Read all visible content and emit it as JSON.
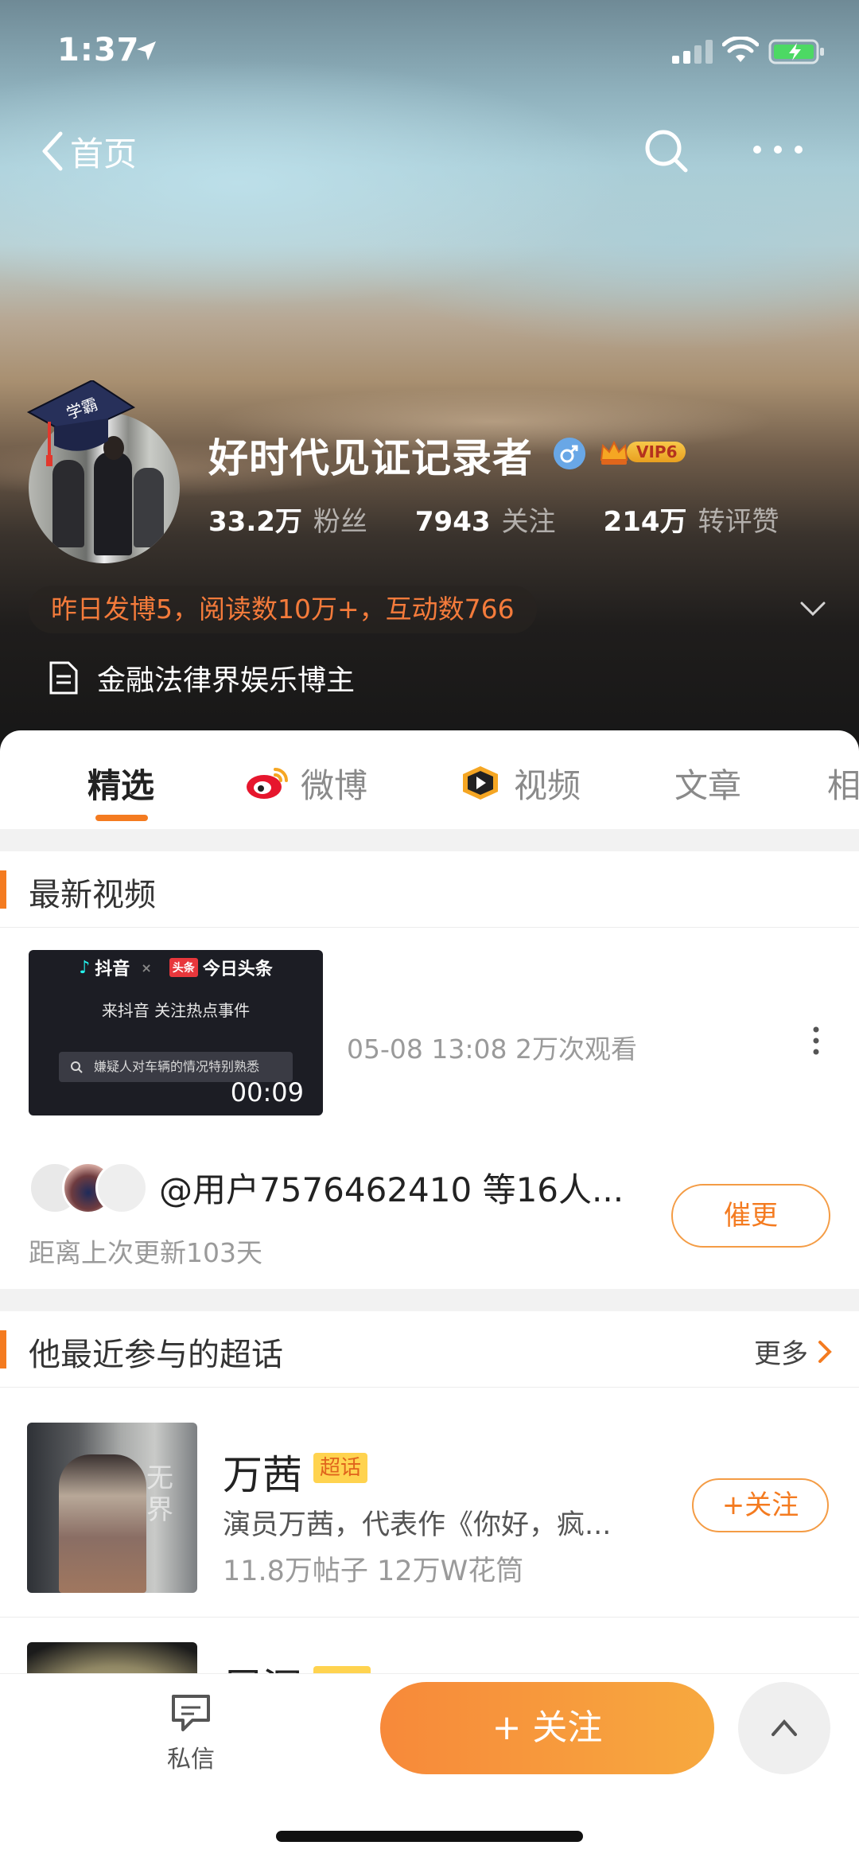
{
  "status_bar": {
    "time": "1:37"
  },
  "nav": {
    "back_label": "首页"
  },
  "profile": {
    "name": "好时代见证记录者",
    "cap_text": "学霸",
    "vip_label": "VIP6",
    "stats": [
      {
        "value": "33.2万",
        "label": "粉丝"
      },
      {
        "value": "7943",
        "label": "关注"
      },
      {
        "value": "214万",
        "label": "转评赞"
      }
    ],
    "summary": "昨日发博5，阅读数10万+，互动数766",
    "bio": "金融法律界娱乐博主"
  },
  "tabs": [
    {
      "label": "精选",
      "active": true
    },
    {
      "label": "微博",
      "icon": "weibo-icon"
    },
    {
      "label": "视频",
      "icon": "video-play-icon"
    },
    {
      "label": "文章"
    },
    {
      "label": "相"
    }
  ],
  "latest_video": {
    "section_title": "最新视频",
    "thumb_brand_1": "抖音",
    "thumb_brand_2_tag": "头条",
    "thumb_brand_2": "今日头条",
    "thumb_line": "来抖音 关注热点事件",
    "thumb_search": "嫌疑人对车辆的情况特别熟悉",
    "duration": "00:09",
    "meta": "05-08 13:08 2万次观看"
  },
  "update_request": {
    "text": "@用户7576462410 等16人...",
    "sub": "距离上次更新103天",
    "button": "催更"
  },
  "super_topics": {
    "section_title": "他最近参与的超话",
    "more_label": "更多",
    "items": [
      {
        "name": "万茜",
        "tag": "超话",
        "img_text": "无界",
        "desc": "演员万茜，代表作《你好，疯...",
        "stats": "11.8万帖子 12万W花筒",
        "follow_label": "+关注"
      },
      {
        "name": "周深"
      }
    ]
  },
  "bottom_bar": {
    "dm_label": "私信",
    "follow_label": "+ 关注"
  },
  "colors": {
    "accent": "#f47b20",
    "vip_gold": "#f7c84a",
    "gender_blue": "#69a7e6"
  }
}
